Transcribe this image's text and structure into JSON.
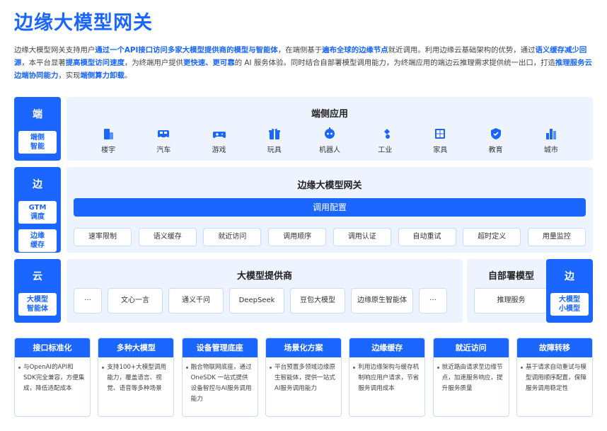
{
  "title": "边缘大模型网关",
  "intro": [
    {
      "t": "边缘大模型网关支持用户",
      "h": false
    },
    {
      "t": "通过一个API接口访问多家大模型提供商的模型与智能体",
      "h": true
    },
    {
      "t": "，在端侧基于",
      "h": false
    },
    {
      "t": "遍布全球的边缘节点",
      "h": true
    },
    {
      "t": "就近调用。利用边缘云基础架构的优势，通过",
      "h": false
    },
    {
      "t": "语义缓存减少回源",
      "h": true
    },
    {
      "t": "，本平台显著",
      "h": false
    },
    {
      "t": "提高模型访问速度",
      "h": true
    },
    {
      "t": "，为终端用户提供",
      "h": false
    },
    {
      "t": "更快速、更可靠",
      "h": true
    },
    {
      "t": "的 AI 服务体验。同时结合自部署模型调用能力，为终端应用的端边云推理需求提供统一出口，打造",
      "h": false
    },
    {
      "t": "推理服务云边端协同能力",
      "h": true
    },
    {
      "t": "，实现",
      "h": false
    },
    {
      "t": "端侧算力卸载",
      "h": true
    },
    {
      "t": "。",
      "h": false
    }
  ],
  "end_row": {
    "label": "端",
    "sub": "端侧\n智能",
    "title": "端侧应用",
    "apps": [
      {
        "label": "楼宇",
        "icon": "building-icon"
      },
      {
        "label": "汽车",
        "icon": "car-icon"
      },
      {
        "label": "游戏",
        "icon": "gamepad-icon"
      },
      {
        "label": "玩具",
        "icon": "toy-icon"
      },
      {
        "label": "机器人",
        "icon": "robot-icon"
      },
      {
        "label": "工业",
        "icon": "industry-icon"
      },
      {
        "label": "家具",
        "icon": "furniture-icon"
      },
      {
        "label": "教育",
        "icon": "education-icon"
      },
      {
        "label": "城市",
        "icon": "city-icon"
      }
    ]
  },
  "edge_row": {
    "label": "边",
    "subs": [
      "GTM\n调度",
      "边缘\n缓存"
    ],
    "title": "边缘大模型网关",
    "config": "调用配置",
    "chips": [
      "速率限制",
      "语义缓存",
      "就近访问",
      "调用顺序",
      "调用认证",
      "自动重试",
      "超时定义",
      "用量监控"
    ]
  },
  "cloud_row": {
    "label": "云",
    "sub": "大模型\n智能体",
    "title": "大模型提供商",
    "providers": [
      "···",
      "文心一言",
      "通义千问",
      "DeepSeek",
      "豆包大模型",
      "边缘原生智能体",
      "···"
    ],
    "self_title": "自部署模型",
    "self_chip": "推理服务",
    "right_label": "边",
    "right_sub": "大模型\n小模型"
  },
  "features": [
    {
      "title": "接口标准化",
      "desc": "与OpenAI的API和SDK完全兼容，方便集成，降低适配成本"
    },
    {
      "title": "多种大模型",
      "desc": "支持100+大模型调用能力，覆盖语言、视觉、语音等多种场景"
    },
    {
      "title": "设备管理底座",
      "desc": "融合物联网底座，通过 OneSDK 一站式提供设备智控与AI服务调用能力"
    },
    {
      "title": "场景化方案",
      "desc": "平台预置多领域边缘原生智能体，提供一站式AI服务调用能力"
    },
    {
      "title": "边缘缓存",
      "desc": "利用边缘架构与缓存机制响应用户请求，节省服务调用成本"
    },
    {
      "title": "就近访问",
      "desc": "就近路由请求至边缘节点，加速服务响应，提升服务质量"
    },
    {
      "title": "故障转移",
      "desc": "基于请求自动重试与模型调用顺序配置，保障服务调用稳定性"
    }
  ],
  "colors": {
    "primary": "#1a66ff",
    "panel": "#eef4ff"
  }
}
